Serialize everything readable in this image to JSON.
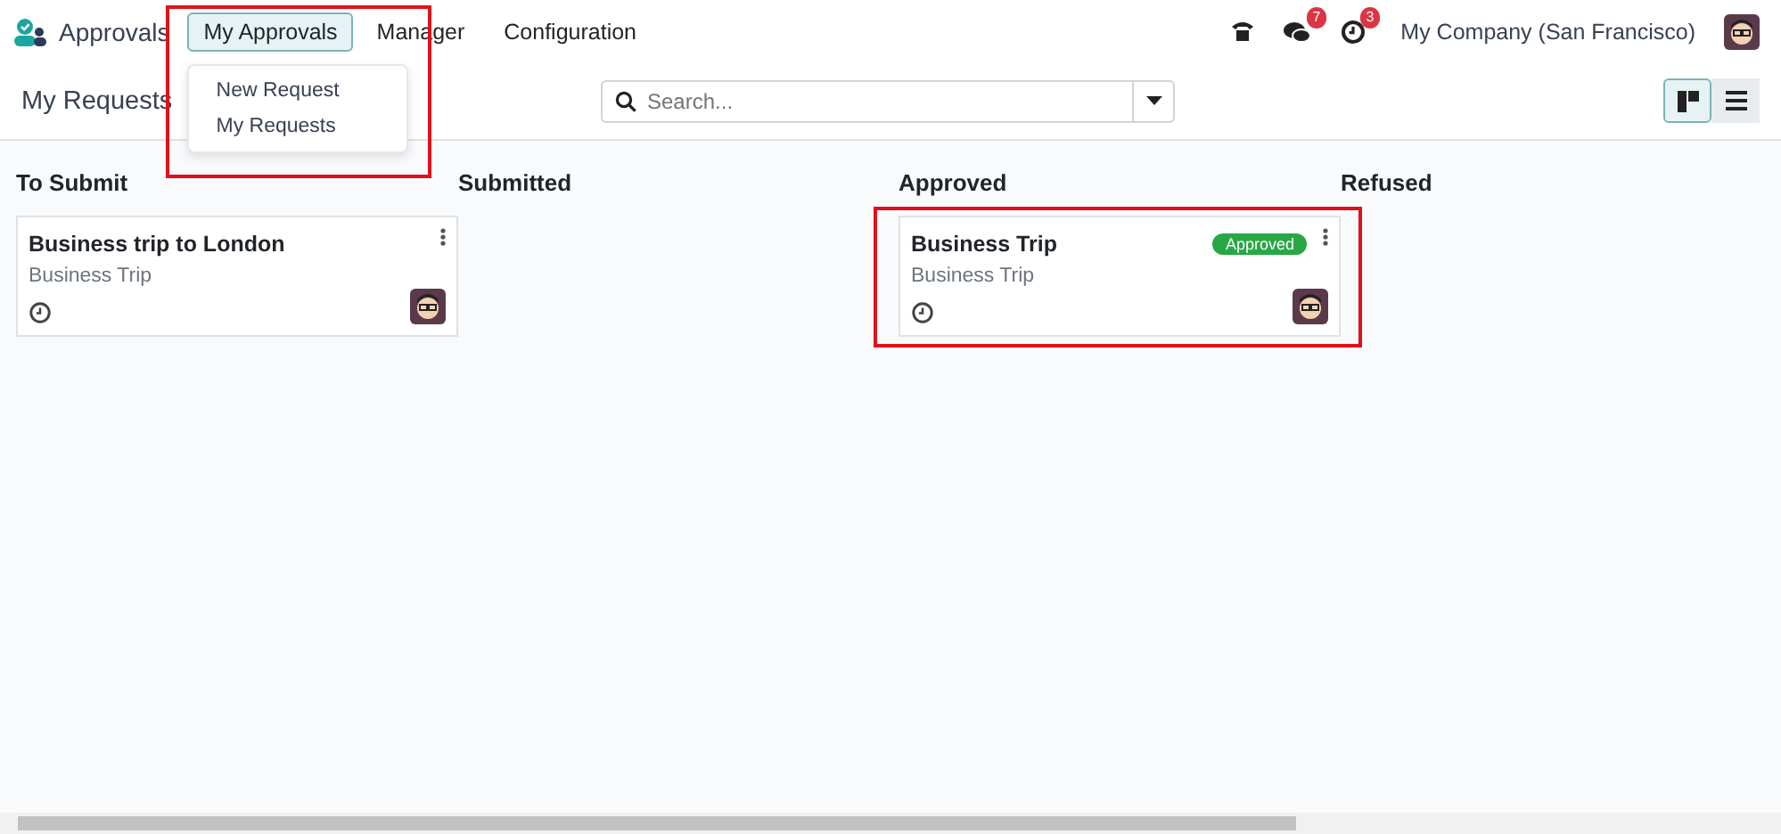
{
  "app": {
    "name": "Approvals"
  },
  "menu": [
    {
      "label": "My Approvals",
      "selected": true
    },
    {
      "label": "Manager",
      "selected": false
    },
    {
      "label": "Configuration",
      "selected": false
    }
  ],
  "dropdown": [
    "New Request",
    "My Requests"
  ],
  "systray": {
    "messages_count": "7",
    "activities_count": "3",
    "company": "My Company (San Francisco)"
  },
  "breadcrumb": "My Requests",
  "search": {
    "placeholder": "Search..."
  },
  "views": [
    {
      "kind": "kanban",
      "selected": true
    },
    {
      "kind": "list",
      "selected": false
    }
  ],
  "columns": [
    {
      "title": "To Submit",
      "cards": [
        {
          "title": "Business trip to London",
          "category": "Business Trip"
        }
      ]
    },
    {
      "title": "Submitted"
    },
    {
      "title": "Approved",
      "cards": [
        {
          "title": "Business Trip",
          "category": "Business Trip",
          "status": "Approved",
          "highlighted": true
        }
      ]
    },
    {
      "title": "Refused"
    }
  ]
}
